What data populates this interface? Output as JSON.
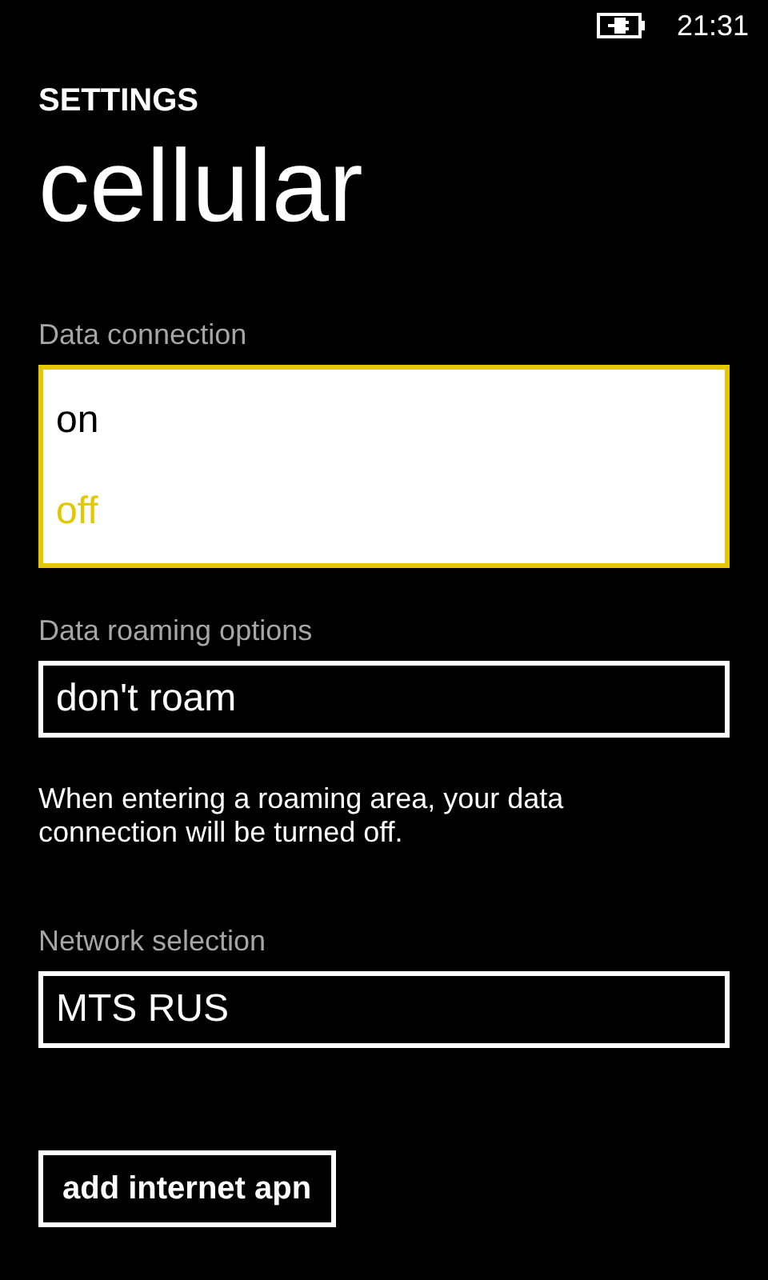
{
  "status_bar": {
    "time": "21:31"
  },
  "header": {
    "app": "SETTINGS",
    "title": "cellular"
  },
  "data_connection": {
    "label": "Data connection",
    "expanded": true,
    "options": [
      {
        "label": "on",
        "selected": false
      },
      {
        "label": "off",
        "selected": true
      }
    ]
  },
  "data_roaming": {
    "label": "Data roaming options",
    "value": "don't roam",
    "note": "When entering a roaming area, your data connection will be turned off."
  },
  "network_selection": {
    "label": "Network selection",
    "value": "MTS RUS"
  },
  "buttons": [
    "add internet apn"
  ]
}
